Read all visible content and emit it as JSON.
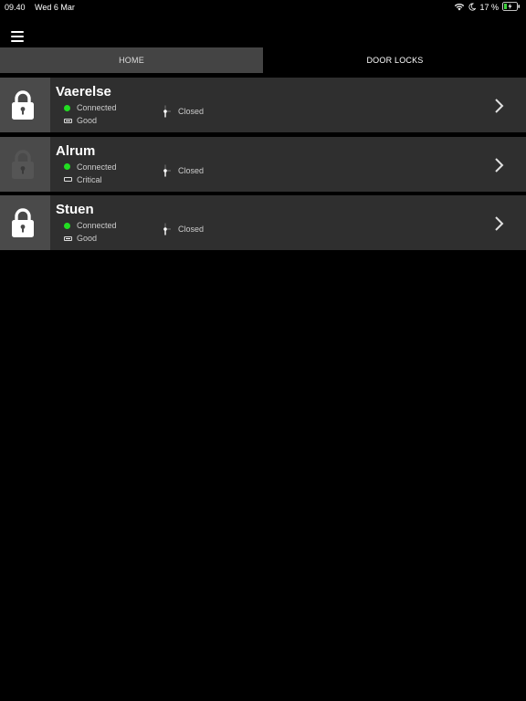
{
  "status_bar": {
    "time": "09.40",
    "date": "Wed 6 Mar",
    "battery_percent": "17 %",
    "icons": [
      "wifi-icon",
      "moon-icon",
      "battery-charging-icon"
    ]
  },
  "nav": {
    "menu_icon": "hamburger-icon",
    "tabs": [
      {
        "label": "HOME"
      },
      {
        "label": "DOOR LOCKS"
      }
    ]
  },
  "locks": [
    {
      "name": "Vaerelse",
      "connection": "Connected",
      "battery": "Good",
      "door": "Closed",
      "lock_active": true,
      "battery_level": 1.0
    },
    {
      "name": "Alrum",
      "connection": "Connected",
      "battery": "Critical",
      "door": "Closed",
      "lock_active": false,
      "battery_level": 0.0
    },
    {
      "name": "Stuen",
      "connection": "Connected",
      "battery": "Good",
      "door": "Closed",
      "lock_active": true,
      "battery_level": 1.0
    }
  ],
  "colors": {
    "connected": "#22dd22",
    "lock_active": "#ffffff",
    "lock_inactive": "#555555"
  }
}
